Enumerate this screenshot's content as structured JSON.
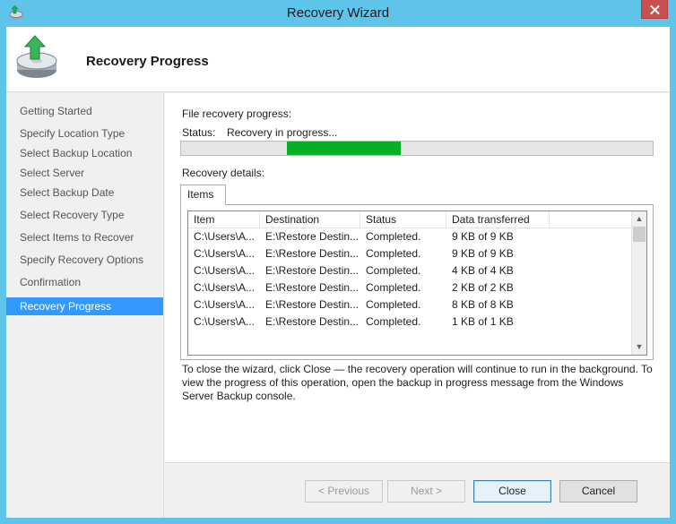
{
  "window": {
    "title": "Recovery Wizard"
  },
  "header": {
    "title": "Recovery Progress"
  },
  "nav": {
    "items": [
      {
        "label": "Getting Started"
      },
      {
        "label": "Specify Location Type"
      },
      {
        "label": "Select Backup Location"
      },
      {
        "label": "Select Server"
      },
      {
        "label": "Select Backup Date"
      },
      {
        "label": "Select Recovery Type"
      },
      {
        "label": "Select Items to Recover"
      },
      {
        "label": "Specify Recovery Options"
      },
      {
        "label": "Confirmation"
      },
      {
        "label": "Recovery Progress"
      }
    ],
    "active_index": 9
  },
  "main": {
    "file_progress_label": "File recovery progress:",
    "status_label": "Status:",
    "status_value": "Recovery in progress...",
    "progress": {
      "bar_color": "#06b025"
    },
    "details_label": "Recovery details:",
    "tab_label": "Items",
    "table": {
      "columns": [
        "Item",
        "Destination",
        "Status",
        "Data transferred"
      ],
      "rows": [
        [
          "C:\\Users\\A...",
          "E:\\Restore Destin...",
          "Completed.",
          "9 KB of 9 KB"
        ],
        [
          "C:\\Users\\A...",
          "E:\\Restore Destin...",
          "Completed.",
          "9 KB of 9 KB"
        ],
        [
          "C:\\Users\\A...",
          "E:\\Restore Destin...",
          "Completed.",
          "4 KB of 4 KB"
        ],
        [
          "C:\\Users\\A...",
          "E:\\Restore Destin...",
          "Completed.",
          "2 KB of 2 KB"
        ],
        [
          "C:\\Users\\A...",
          "E:\\Restore Destin...",
          "Completed.",
          "8 KB of 8 KB"
        ],
        [
          "C:\\Users\\A...",
          "E:\\Restore Destin...",
          "Completed.",
          "1 KB of 1 KB"
        ]
      ]
    },
    "info_text": "To close the wizard, click Close — the recovery operation will continue to run in the background. To view the progress of this operation, open the backup in progress message from the Windows Server Backup console."
  },
  "footer": {
    "previous_label": "< Previous",
    "next_label": "Next >",
    "close_label": "Close",
    "cancel_label": "Cancel"
  },
  "colors": {
    "frame": "#5ec4ea",
    "selection": "#3399ff",
    "progress": "#06b025"
  }
}
